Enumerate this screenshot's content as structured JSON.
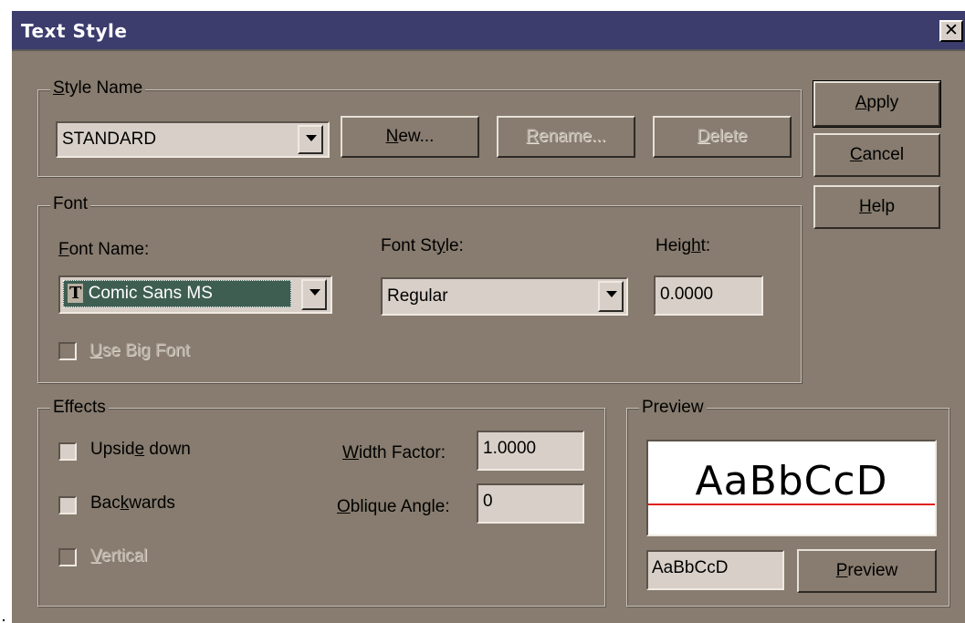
{
  "window": {
    "title": "Text Style",
    "close_glyph": "✕"
  },
  "buttons": {
    "apply": {
      "pre": "",
      "accel": "A",
      "post": "pply"
    },
    "cancel": {
      "pre": "",
      "accel": "C",
      "post": "ancel"
    },
    "help": {
      "pre": "",
      "accel": "H",
      "post": "elp"
    }
  },
  "style_name": {
    "legend": {
      "pre": "",
      "accel": "S",
      "post": "tyle Name"
    },
    "selected": "STANDARD",
    "new": {
      "pre": "",
      "accel": "N",
      "post": "ew..."
    },
    "rename": {
      "pre": "",
      "accel": "R",
      "post": "ename..."
    },
    "delete": {
      "pre": "",
      "accel": "D",
      "post": "elete"
    }
  },
  "font": {
    "legend": "Font",
    "font_name_label": {
      "pre": "",
      "accel": "F",
      "post": "ont Name:"
    },
    "font_name_value": "Comic Sans MS",
    "font_icon": "truetype-icon",
    "font_style_label": {
      "pre": "Font St",
      "accel": "y",
      "post": "le:"
    },
    "font_style_value": "Regular",
    "height_label": {
      "pre": "Heig",
      "accel": "h",
      "post": "t:"
    },
    "height_value": "0.0000",
    "big_font": {
      "pre": "",
      "accel": "U",
      "post": "se Big Font",
      "checked": false,
      "enabled": false
    }
  },
  "effects": {
    "legend": "Effects",
    "upside_down": {
      "pre": "Upsid",
      "accel": "e",
      "post": " down",
      "checked": false
    },
    "backwards": {
      "pre": "Bac",
      "accel": "k",
      "post": "wards",
      "checked": false
    },
    "vertical": {
      "pre": "",
      "accel": "V",
      "post": "ertical",
      "checked": false,
      "enabled": false
    },
    "width_factor_label": {
      "pre": "",
      "accel": "W",
      "post": "idth Factor:"
    },
    "width_factor_value": "1.0000",
    "oblique_label": {
      "pre": "",
      "accel": "O",
      "post": "blique Angle:"
    },
    "oblique_value": "0"
  },
  "preview": {
    "legend": "Preview",
    "sample_text": "AaBbCcD",
    "input_value": "AaBbCcD",
    "button": {
      "pre": "",
      "accel": "P",
      "post": "review"
    },
    "baseline_color": "#e02020"
  }
}
